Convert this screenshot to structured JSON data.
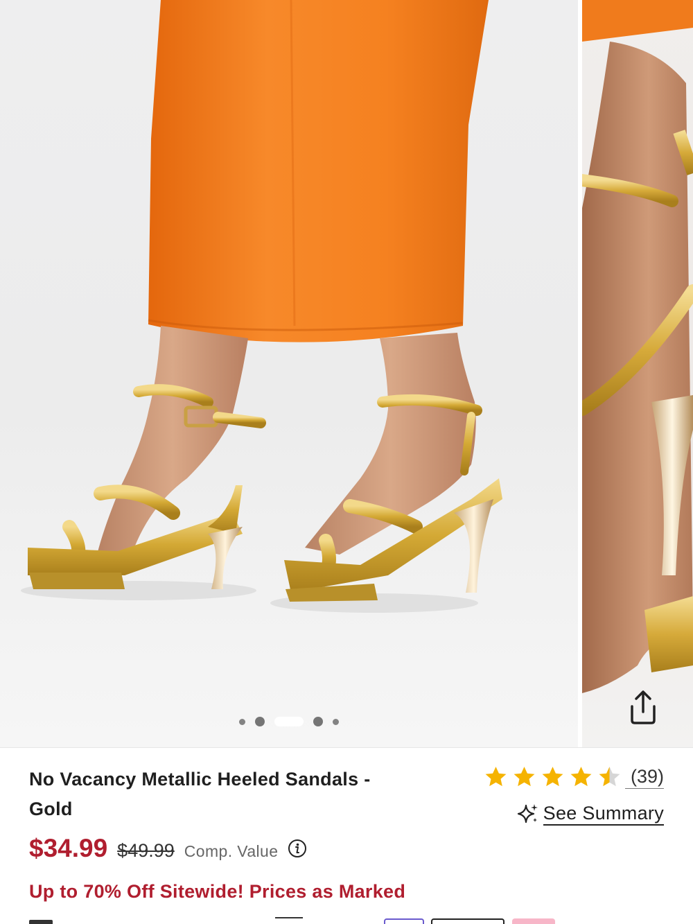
{
  "product": {
    "title": "No Vacancy Metallic Heeled Sandals - Gold",
    "price": "$34.99",
    "original_price": "$49.99",
    "comp_value_label": "Comp. Value",
    "promo": "Up to 70% Off Sitewide! Prices as Marked"
  },
  "rating": {
    "value": 4.5,
    "max": 5,
    "count_label": "(39)",
    "star_color": "#f5b301"
  },
  "summary": {
    "label": "See Summary",
    "icon": "sparkle-icon"
  },
  "carousel": {
    "total_slides": 5,
    "active_index": 2
  },
  "icons": {
    "share": "share-icon",
    "info": "info-icon"
  },
  "colors": {
    "price_red": "#b01e2f",
    "skirt_orange": "#f07b1c",
    "sandal_gold": "#d9b13f"
  }
}
